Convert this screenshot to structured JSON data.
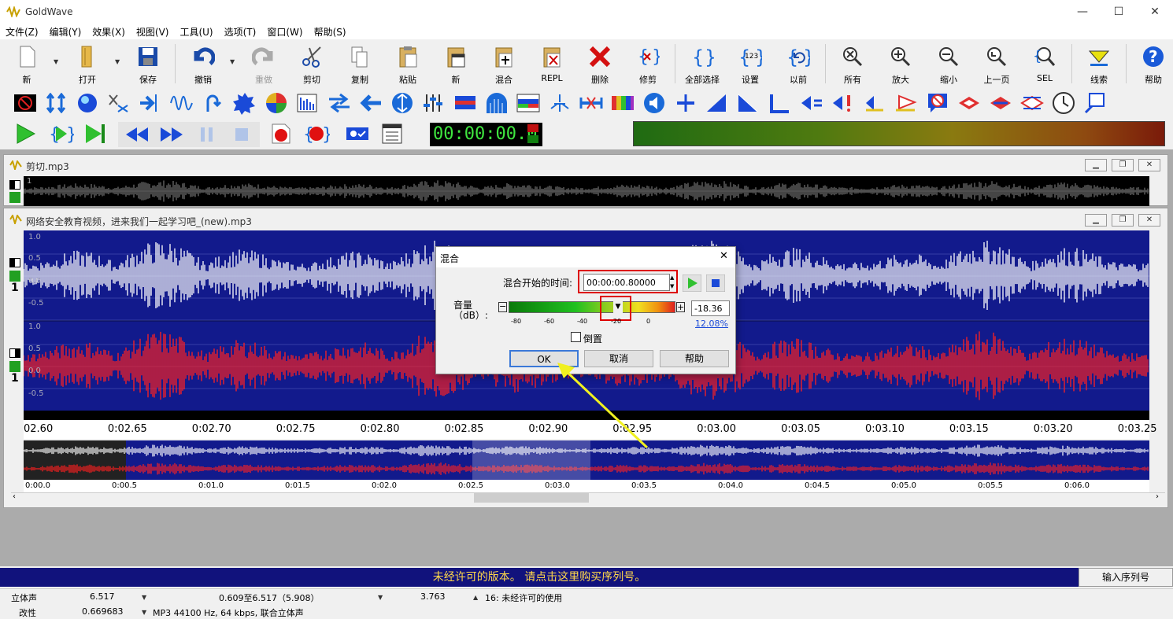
{
  "app": {
    "title": "GoldWave"
  },
  "menu": [
    "文件(Z)",
    "编辑(Y)",
    "效果(X)",
    "视图(V)",
    "工具(U)",
    "选项(T)",
    "窗口(W)",
    "帮助(S)"
  ],
  "toolbar": {
    "new": "新",
    "open": "打开",
    "save": "保存",
    "undo": "撤销",
    "redo": "重做",
    "cut": "剪切",
    "copy": "复制",
    "paste": "粘贴",
    "new2": "新",
    "mix": "混合",
    "repl": "REPL",
    "delete": "删除",
    "trim": "修剪",
    "select_all": "全部选择",
    "set": "设置",
    "previous": "以前",
    "all": "所有",
    "zoom_in": "放大",
    "zoom_out": "缩小",
    "prev_page": "上一页",
    "sel": "SEL",
    "cue": "线索",
    "help": "帮助"
  },
  "transport": {
    "time": "00:00:00.0"
  },
  "windows": {
    "back_title": "剪切.mp3",
    "back_scale": "1",
    "front_title": "网络安全教育视频，进来我们一起学习吧_(new).mp3"
  },
  "waveform": {
    "left_axis": [
      "1.0",
      "0.5",
      "0.0",
      "-0.5"
    ],
    "right_axis": [
      "1.0",
      "0.5",
      "0.0",
      "-0.5"
    ],
    "channel_num_l": "1",
    "channel_num_r": "1",
    "timeline": [
      "02.60",
      "0:02.65",
      "0:02.70",
      "0:02.75",
      "0:02.80",
      "0:02.85",
      "0:02.90",
      "0:02.95",
      "0:03.00",
      "0:03.05",
      "0:03.10",
      "0:03.15",
      "0:03.20",
      "0:03.25"
    ],
    "overview_timeline": [
      "0:00.0",
      "0:00.5",
      "0:01.0",
      "0:01.5",
      "0:02.0",
      "0:02.5",
      "0:03.0",
      "0:03.5",
      "0:04.0",
      "0:04.5",
      "0:05.0",
      "0:05.5",
      "0:06.0"
    ]
  },
  "dialog": {
    "title": "混合",
    "start_label": "混合开始的时间:",
    "start_value": "00:00:00.80000",
    "volume_label": "音量（dB）:",
    "db_ticks": [
      "-80",
      "-60",
      "-40",
      "-20",
      "0"
    ],
    "db_value": "-18.36",
    "percent": "12.08%",
    "invert_label": "倒置",
    "ok": "OK",
    "cancel": "取消",
    "help": "帮助",
    "close": "✕"
  },
  "registration": {
    "message": "未经许可的版本。 请点击这里购买序列号。",
    "button": "输入序列号"
  },
  "status": {
    "r1c1": "立体声",
    "r1c2": "6.517",
    "r1c3": "0.609至6.517（5.908）",
    "r1c4": "3.763",
    "r1c5": "16: 未经许可的使用",
    "r2c1": "改性",
    "r2c2": "0.669683",
    "r2c3": "MP3 44100 Hz, 64 kbps, 联合立体声"
  },
  "colors": {
    "wave_bg": "#121a8c",
    "left_wave": "#ffffff",
    "right_wave": "#ff2020",
    "reg_bg": "#11127c",
    "reg_text": "#ffd84a"
  }
}
